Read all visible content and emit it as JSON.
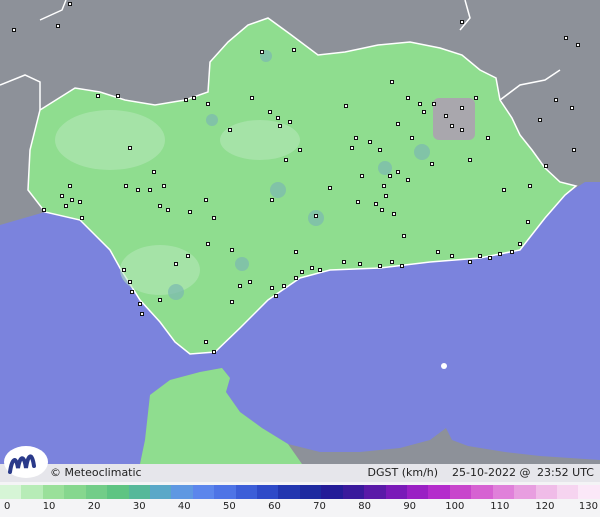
{
  "map": {
    "credit_text": "© Meteoclimatic",
    "variable": "DGST (km/h)",
    "date": "25-10-2022 @",
    "time": "23:52 UTC",
    "colors": {
      "sea": "#7b83dd",
      "land_outside": "#8d9199",
      "region_fill": "#8fdd8f",
      "region_highlight": "#b8e8bc",
      "mountain_patch": "#a9a7ad",
      "calm_spot": "#7ab8b0",
      "station_marker": "#111111"
    }
  },
  "legend": {
    "labels": [
      "0",
      "10",
      "20",
      "30",
      "40",
      "50",
      "60",
      "70",
      "80",
      "90",
      "100",
      "110",
      "120",
      "130"
    ],
    "colors": [
      "#d6f5d6",
      "#b7ecb7",
      "#9ae09a",
      "#86d78e",
      "#72cd88",
      "#5ec482",
      "#56b89a",
      "#5aa8c8",
      "#5f98e2",
      "#5c86ec",
      "#4e74e6",
      "#3c5ed8",
      "#2e4ac8",
      "#2236b0",
      "#1e2aa0",
      "#241c98",
      "#3a1a9c",
      "#5a1aa8",
      "#7a1ab8",
      "#9a20c4",
      "#b42ccc",
      "#c846cc",
      "#d662d2",
      "#e080da",
      "#e89ee0",
      "#f0bce8",
      "#f6d4f0",
      "#fbe8f8"
    ]
  }
}
